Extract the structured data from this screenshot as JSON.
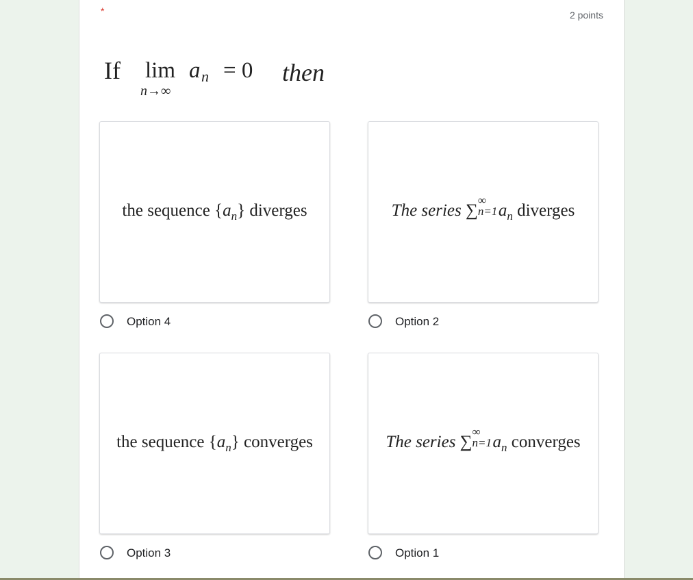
{
  "header": {
    "required_mark": "*",
    "points": "2 points"
  },
  "question": {
    "if": "If",
    "lim": "lim",
    "subscript": "n→∞",
    "a": "a",
    "n": "n",
    "equals": "= 0",
    "then": "then"
  },
  "options": [
    {
      "pre": "the sequence ",
      "open": "{",
      "var": "a",
      "sub": "n",
      "close": "}",
      "post": " diverges",
      "label": "Option 4"
    },
    {
      "pre": "The series ",
      "sigma": "∑",
      "sup": "∞",
      "subvar": "n=1",
      "var": "a",
      "sub": "n",
      "post": " diverges",
      "label": "Option 2"
    },
    {
      "pre": "the sequence ",
      "open": "{",
      "var": "a",
      "sub": "n",
      "close": "}",
      "post": " converges",
      "label": "Option 3"
    },
    {
      "pre": "The series ",
      "sigma": "∑",
      "sup": "∞",
      "subvar": "n=1",
      "var": "a",
      "sub": "n",
      "post": " converges",
      "label": "Option 1"
    }
  ]
}
